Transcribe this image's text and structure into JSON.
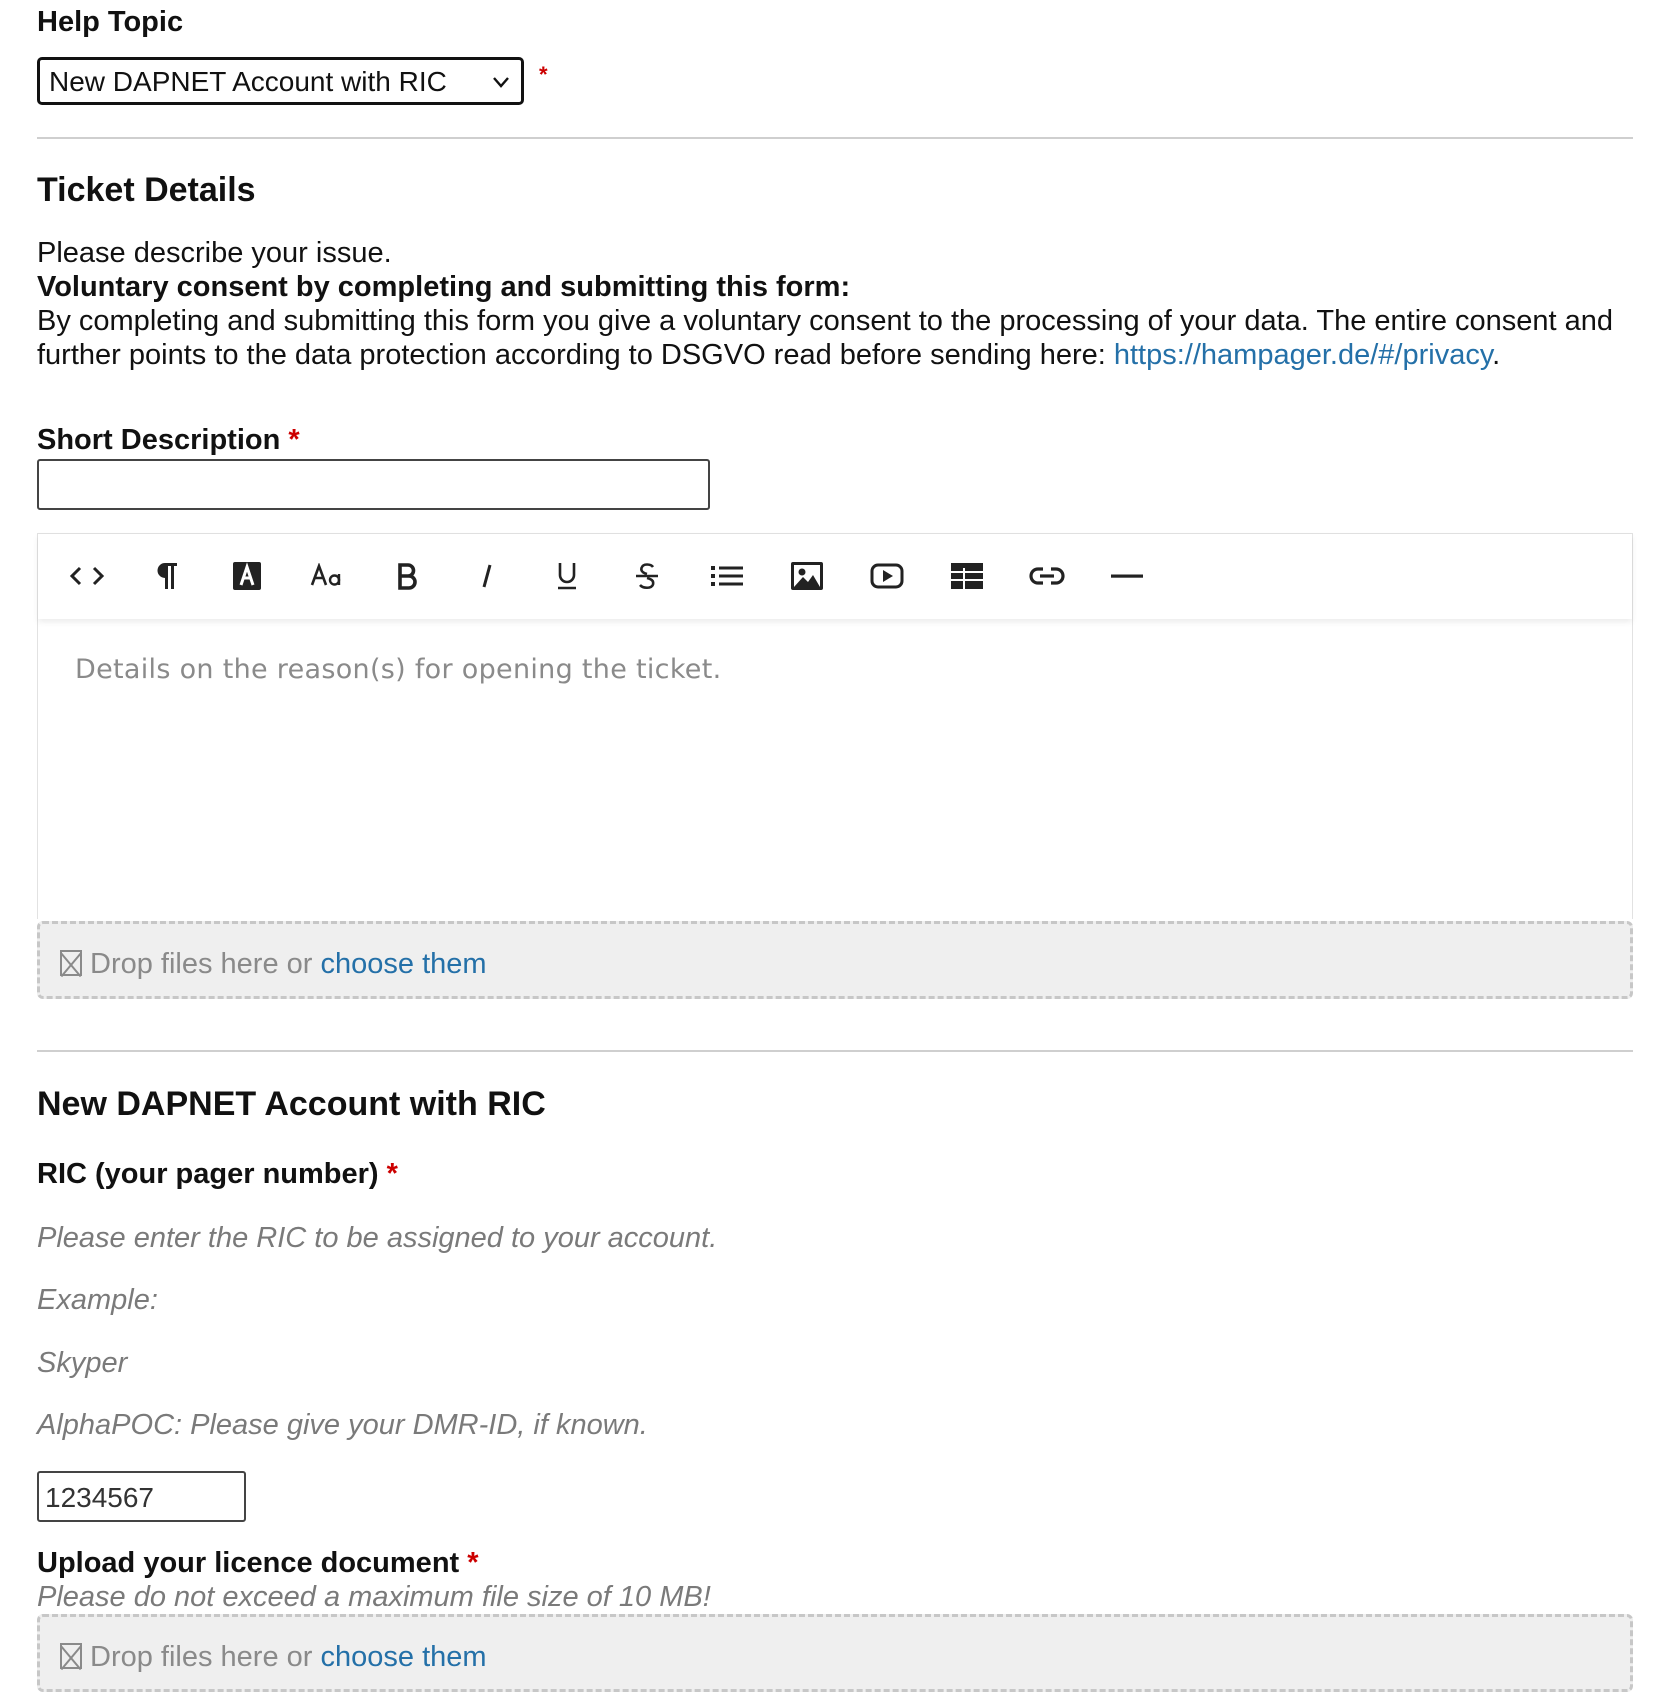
{
  "help_topic": {
    "label": "Help Topic",
    "selected": "New DAPNET Account with RIC",
    "required_mark": "*"
  },
  "ticket_details": {
    "title": "Ticket Details",
    "intro_line": "Please describe your issue.",
    "consent_heading": "Voluntary consent by completing and submitting this form:",
    "consent_text": "By completing and submitting this form you give a voluntary consent to the processing of your data. The entire consent and further points to the data protection according to DSGVO read before sending here: ",
    "privacy_link": "https://hampager.de/#/privacy",
    "trailing_period": "."
  },
  "short_description": {
    "label": "Short Description",
    "required_mark": "*",
    "value": ""
  },
  "editor": {
    "toolbar": [
      {
        "name": "code-view",
        "icon": "code-icon"
      },
      {
        "name": "paragraph",
        "icon": "paragraph-icon"
      },
      {
        "name": "text-color",
        "icon": "text-color-icon"
      },
      {
        "name": "font-size",
        "icon": "font-size-icon"
      },
      {
        "name": "bold",
        "icon": "bold-icon"
      },
      {
        "name": "italic",
        "icon": "italic-icon"
      },
      {
        "name": "underline",
        "icon": "underline-icon"
      },
      {
        "name": "strikethrough",
        "icon": "strikethrough-icon"
      },
      {
        "name": "list",
        "icon": "list-icon"
      },
      {
        "name": "image",
        "icon": "image-icon"
      },
      {
        "name": "video",
        "icon": "video-icon"
      },
      {
        "name": "table",
        "icon": "table-icon"
      },
      {
        "name": "link",
        "icon": "link-icon"
      },
      {
        "name": "horizontal-rule",
        "icon": "horizontal-rule-icon"
      }
    ],
    "placeholder": "Details on the reason(s) for opening the ticket."
  },
  "editor_dropzone": {
    "text": "Drop files here or ",
    "link": "choose them"
  },
  "dapnet_section": {
    "title": "New DAPNET Account with RIC",
    "ric_label": "RIC (your pager number)",
    "ric_required_mark": "*",
    "hints": [
      "Please enter the RIC to be assigned to your account.",
      "Example:",
      "Skyper",
      "AlphaPOC: Please give your DMR-ID, if known."
    ],
    "ric_placeholder": "1234567",
    "upload_label": "Upload your licence document",
    "upload_required_mark": "*",
    "upload_hint": "Please do not exceed a maximum file size of 10 MB!",
    "upload_dropzone": {
      "text": "Drop files here or ",
      "link": "choose them"
    }
  }
}
